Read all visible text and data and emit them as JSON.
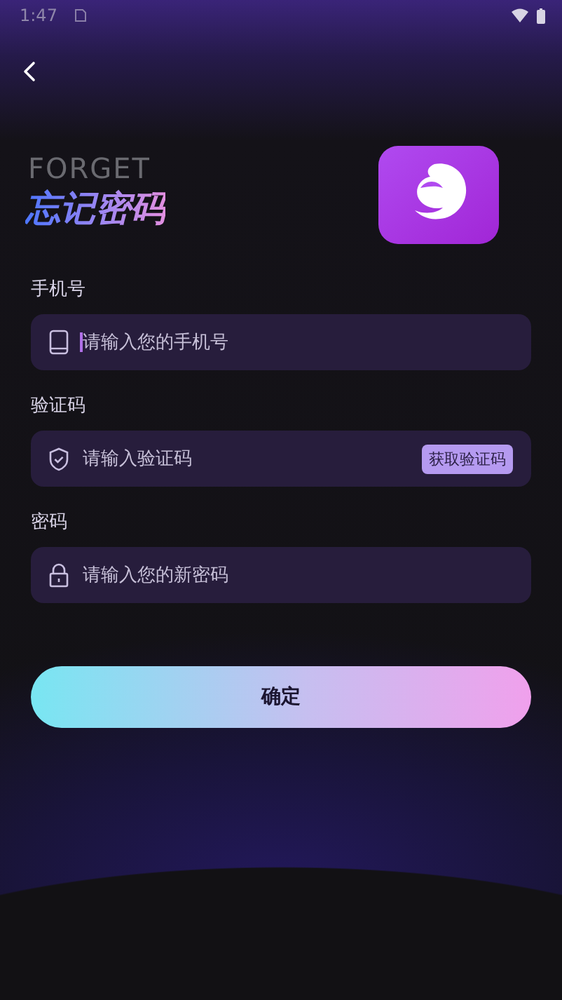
{
  "status_bar": {
    "time": "1:47"
  },
  "header": {
    "title_en": "FORGET",
    "title": "忘记密码"
  },
  "fields": [
    {
      "kind": "phone",
      "label": "手机号",
      "placeholder": "请输入您的手机号",
      "focused": true
    },
    {
      "kind": "code",
      "label": "验证码",
      "placeholder": "请输入验证码",
      "button": "获取验证码"
    },
    {
      "kind": "password",
      "label": "密码",
      "placeholder": "请输入您的新密码"
    }
  ],
  "submit": "确定"
}
